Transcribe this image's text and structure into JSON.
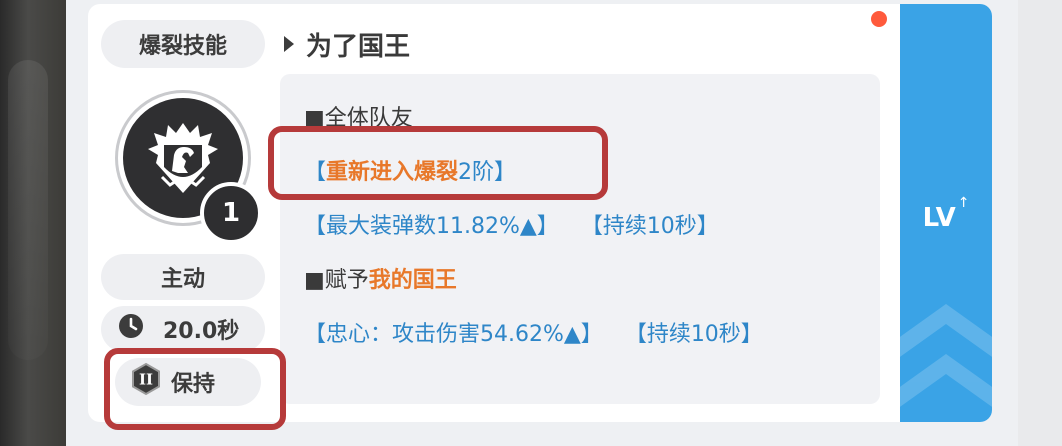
{
  "skill": {
    "type_label": "爆裂技能",
    "name": "为了国王",
    "level": "1",
    "activation": "主动",
    "cooldown": "20.0秒",
    "duration_label": "保持",
    "duration_rank": "II"
  },
  "description": {
    "line1": "■全体队友",
    "line2_open": "【",
    "line2_highlight": "重新进入爆裂",
    "line2_rest": "2阶】",
    "line3_a": "【最大装弹数11.82%▲】",
    "line3_b": "【持续10秒】",
    "line4_prefix": "■赋予",
    "line4_highlight": "我的国王",
    "line5_a": "【忠心：攻击伤害54.62%▲】",
    "line5_b": "【持续10秒】"
  },
  "upgrade": {
    "label": "LV",
    "arrow": "↑"
  },
  "icons": {
    "emblem": "lion-shield-icon",
    "clock": "clock-icon",
    "rank": "hexagon-rank-icon",
    "triangle": "play-triangle-icon",
    "notification": "notification-dot-icon"
  },
  "colors": {
    "accent_blue": "#3aa3e6",
    "text_blue": "#2e86c8",
    "highlight_orange": "#e8782a",
    "annotation_red": "#b63a3a"
  }
}
